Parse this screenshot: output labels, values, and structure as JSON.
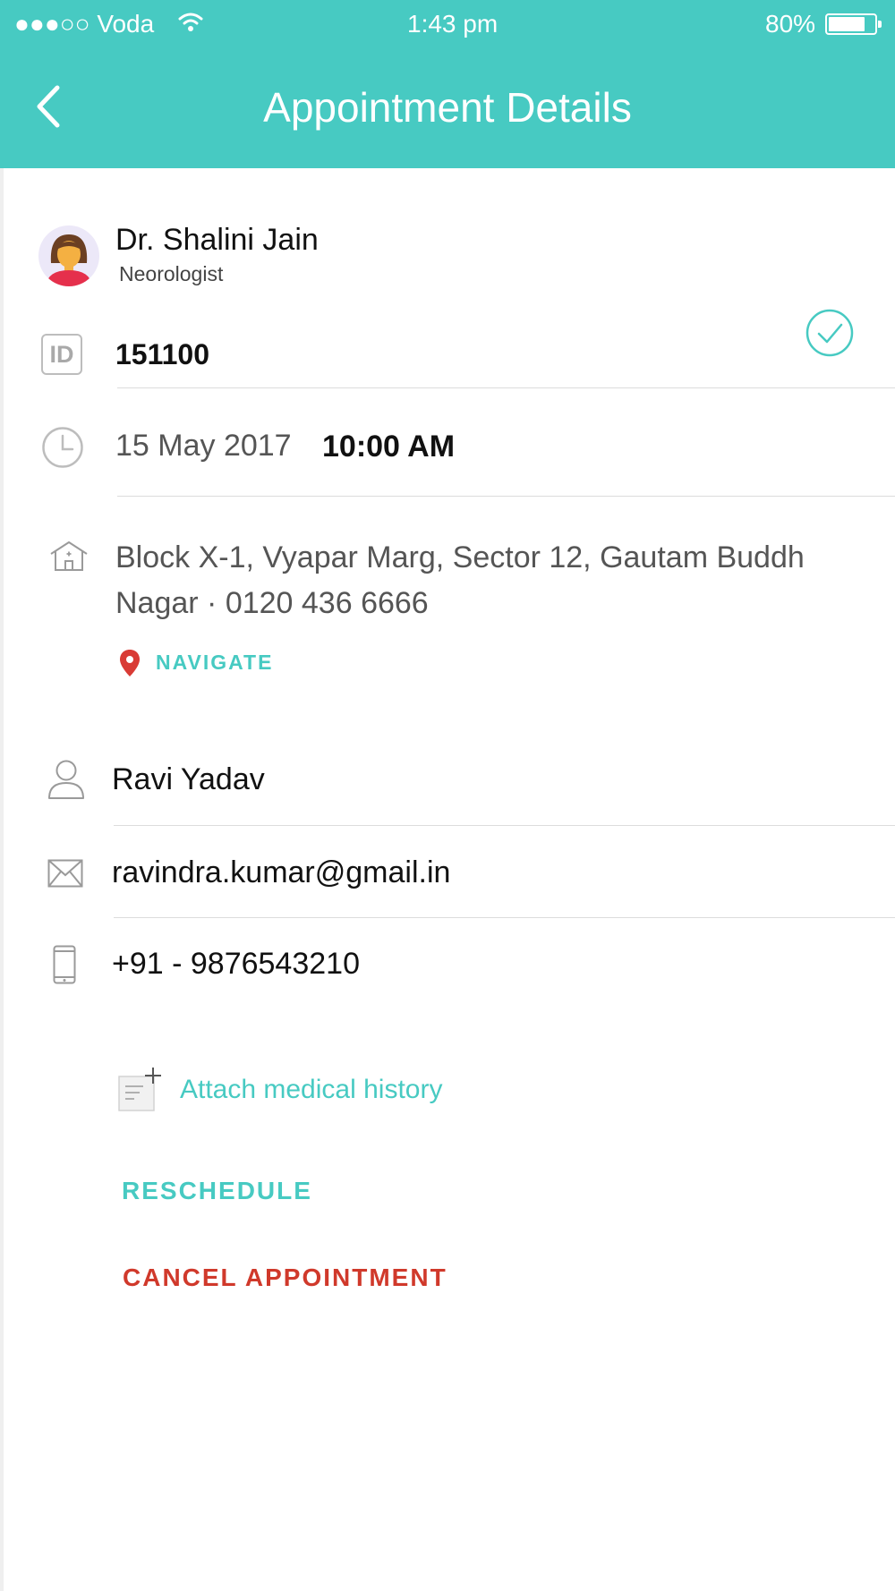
{
  "status_bar": {
    "carrier": "●●●○○ Voda",
    "time": "1:43 pm",
    "battery": "80%",
    "battery_level": 0.8
  },
  "header": {
    "title": "Appointment Details",
    "back_icon": "chevron-left-icon"
  },
  "doctor": {
    "name": "Dr. Shalini Jain",
    "specialty": "Neorologist",
    "avatar_icon": "doctor-avatar"
  },
  "appointment": {
    "id_icon_text": "ID",
    "id": "151100",
    "status_icon": "check-circle-icon",
    "date": "15 May 2017",
    "time": "10:00 AM"
  },
  "address": {
    "line1": "Block X-1, Vyapar Marg, Sector 12, Gautam Buddh",
    "line2": "Nagar · 0120 436 6666",
    "navigate_label": "NAVIGATE",
    "pin_icon": "map-pin-icon"
  },
  "patient": {
    "name": "Ravi Yadav",
    "email": "ravindra.kumar@gmail.in",
    "phone": "+91 - 9876543210"
  },
  "actions": {
    "attach_label": "Attach medical history",
    "reschedule_label": "RESCHEDULE",
    "cancel_label": "CANCEL APPOINTMENT"
  },
  "colors": {
    "accent": "#47cac2",
    "danger": "#d0392b"
  }
}
